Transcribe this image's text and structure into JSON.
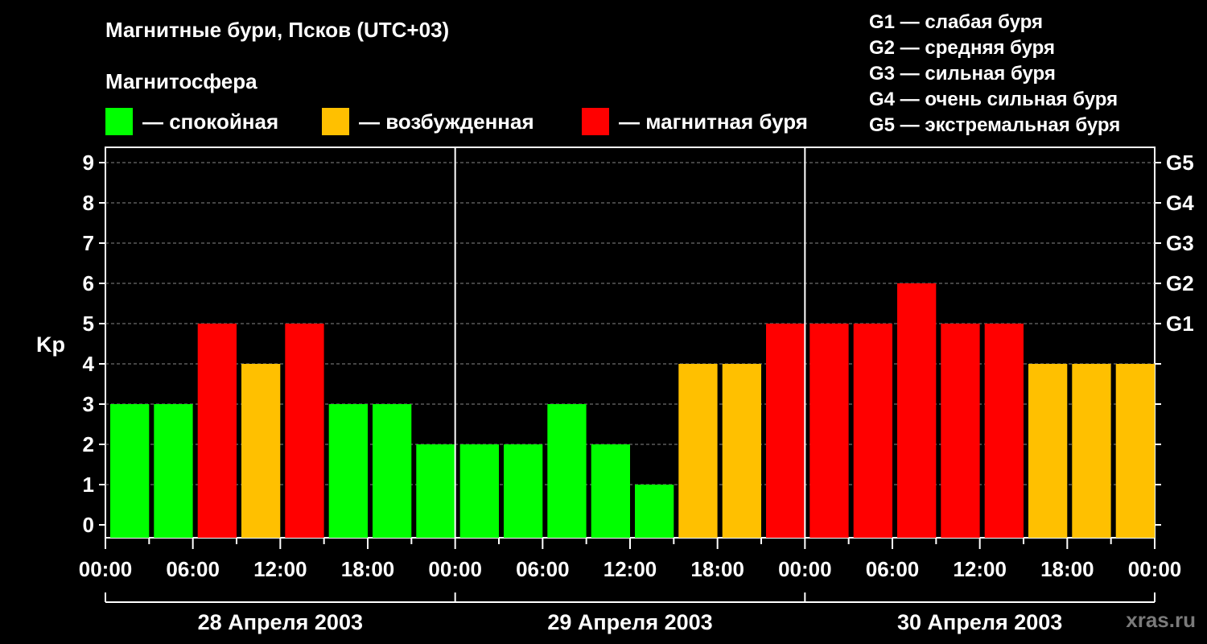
{
  "header": {
    "title": "Магнитные бури, Псков (UTC+03)",
    "subtitle": "Магнитосфера",
    "legend": [
      {
        "label": "— спокойная",
        "color": "#00ff00"
      },
      {
        "label": "— возбужденная",
        "color": "#ffc000"
      },
      {
        "label": "— магнитная буря",
        "color": "#ff0000"
      }
    ],
    "storm_levels": [
      "G1 — слабая буря",
      "G2 — средняя буря",
      "G3 — сильная буря",
      "G4 — очень сильная буря",
      "G5 — экстремальная буря"
    ]
  },
  "watermark": "xras.ru",
  "chart_data": {
    "type": "bar",
    "ylabel": "Kp",
    "ylim": [
      0,
      9
    ],
    "yticks": [
      0,
      1,
      2,
      3,
      4,
      5,
      6,
      7,
      8,
      9
    ],
    "right_ticks": [
      {
        "value": 5,
        "label": "G1"
      },
      {
        "value": 6,
        "label": "G2"
      },
      {
        "value": 7,
        "label": "G3"
      },
      {
        "value": 8,
        "label": "G4"
      },
      {
        "value": 9,
        "label": "G5"
      }
    ],
    "grid": true,
    "days": [
      "28 Апреля 2003",
      "29 Апреля 2003",
      "30 Апреля 2003"
    ],
    "xtick_labels": [
      "00:00",
      "06:00",
      "12:00",
      "18:00",
      "00:00",
      "06:00",
      "12:00",
      "18:00",
      "00:00",
      "06:00",
      "12:00",
      "18:00",
      "00:00"
    ],
    "interval_hours": 3,
    "values": [
      3,
      3,
      5,
      4,
      5,
      3,
      3,
      2,
      2,
      2,
      3,
      2,
      1,
      4,
      4,
      5,
      5,
      5,
      6,
      5,
      5,
      4,
      4,
      4
    ],
    "colors": {
      "quiet": "#00ff00",
      "active": "#ffc000",
      "storm": "#ff0000"
    }
  }
}
